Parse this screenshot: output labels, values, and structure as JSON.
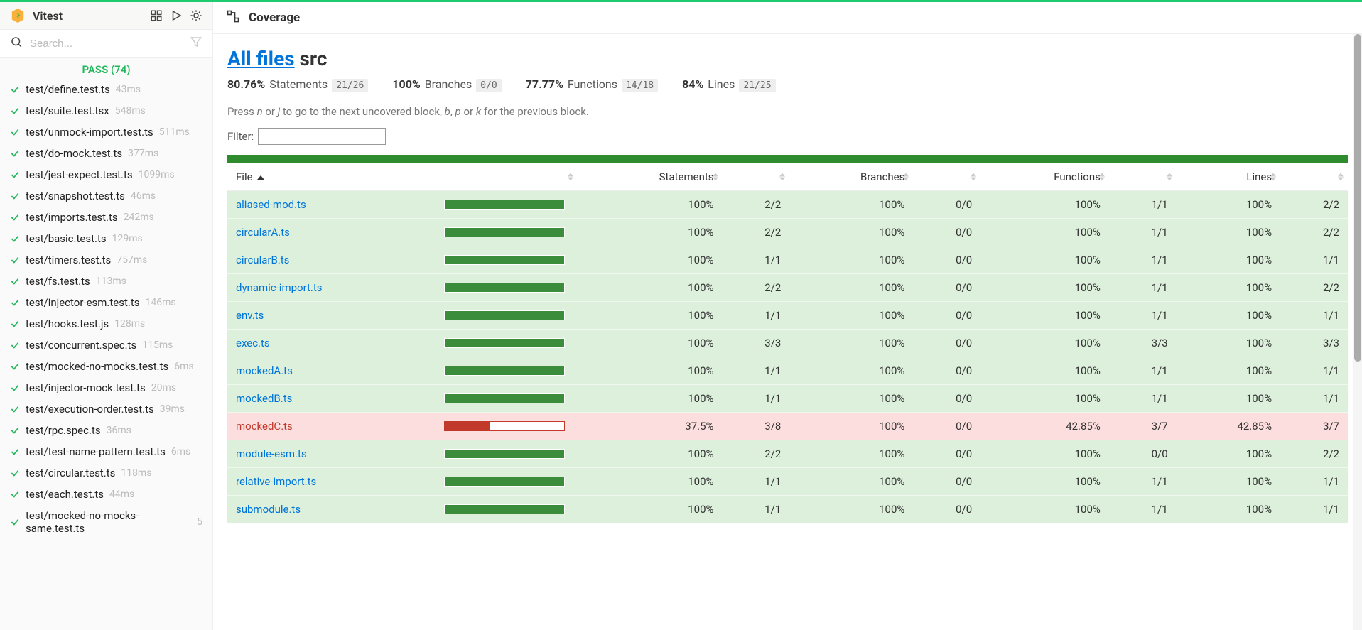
{
  "brand": "Vitest",
  "search_placeholder": "Search...",
  "status_pass_label": "PASS (74)",
  "coverage_header": "Coverage",
  "heading_link": "All files",
  "heading_rest": " src",
  "summary": {
    "statements": {
      "pct": "80.76%",
      "label": "Statements",
      "frac": "21/26"
    },
    "branches": {
      "pct": "100%",
      "label": "Branches",
      "frac": "0/0"
    },
    "functions": {
      "pct": "77.77%",
      "label": "Functions",
      "frac": "14/18"
    },
    "lines": {
      "pct": "84%",
      "label": "Lines",
      "frac": "21/25"
    }
  },
  "hint_html": "Press <i>n</i> or <i>j</i> to go to the next uncovered block, <i>b</i>, <i>p</i> or <i>k</i> for the previous block.",
  "filter_label": "Filter:",
  "table_headers": {
    "file": "File",
    "statements": "Statements",
    "branches": "Branches",
    "functions": "Functions",
    "lines": "Lines"
  },
  "tests": [
    {
      "name": "test/define.test.ts",
      "time": "43ms"
    },
    {
      "name": "test/suite.test.tsx",
      "time": "548ms"
    },
    {
      "name": "test/unmock-import.test.ts",
      "time": "511ms"
    },
    {
      "name": "test/do-mock.test.ts",
      "time": "377ms"
    },
    {
      "name": "test/jest-expect.test.ts",
      "time": "1099ms"
    },
    {
      "name": "test/snapshot.test.ts",
      "time": "46ms"
    },
    {
      "name": "test/imports.test.ts",
      "time": "242ms"
    },
    {
      "name": "test/basic.test.ts",
      "time": "129ms"
    },
    {
      "name": "test/timers.test.ts",
      "time": "757ms"
    },
    {
      "name": "test/fs.test.ts",
      "time": "113ms"
    },
    {
      "name": "test/injector-esm.test.ts",
      "time": "146ms"
    },
    {
      "name": "test/hooks.test.js",
      "time": "128ms"
    },
    {
      "name": "test/concurrent.spec.ts",
      "time": "115ms"
    },
    {
      "name": "test/mocked-no-mocks.test.ts",
      "time": "6ms"
    },
    {
      "name": "test/injector-mock.test.ts",
      "time": "20ms"
    },
    {
      "name": "test/execution-order.test.ts",
      "time": "39ms"
    },
    {
      "name": "test/rpc.spec.ts",
      "time": "36ms"
    },
    {
      "name": "test/test-name-pattern.test.ts",
      "time": "6ms"
    },
    {
      "name": "test/circular.test.ts",
      "time": "118ms"
    },
    {
      "name": "test/each.test.ts",
      "time": "44ms"
    },
    {
      "name": "test/mocked-no-mocks-same.test.ts",
      "time": "5"
    }
  ],
  "rows": [
    {
      "file": "aliased-mod.ts",
      "level": "high",
      "bar": 100,
      "s_pct": "100%",
      "s_frac": "2/2",
      "b_pct": "100%",
      "b_frac": "0/0",
      "f_pct": "100%",
      "f_frac": "1/1",
      "l_pct": "100%",
      "l_frac": "2/2"
    },
    {
      "file": "circularA.ts",
      "level": "high",
      "bar": 100,
      "s_pct": "100%",
      "s_frac": "2/2",
      "b_pct": "100%",
      "b_frac": "0/0",
      "f_pct": "100%",
      "f_frac": "1/1",
      "l_pct": "100%",
      "l_frac": "2/2"
    },
    {
      "file": "circularB.ts",
      "level": "high",
      "bar": 100,
      "s_pct": "100%",
      "s_frac": "1/1",
      "b_pct": "100%",
      "b_frac": "0/0",
      "f_pct": "100%",
      "f_frac": "1/1",
      "l_pct": "100%",
      "l_frac": "1/1"
    },
    {
      "file": "dynamic-import.ts",
      "level": "high",
      "bar": 100,
      "s_pct": "100%",
      "s_frac": "2/2",
      "b_pct": "100%",
      "b_frac": "0/0",
      "f_pct": "100%",
      "f_frac": "1/1",
      "l_pct": "100%",
      "l_frac": "2/2"
    },
    {
      "file": "env.ts",
      "level": "high",
      "bar": 100,
      "s_pct": "100%",
      "s_frac": "1/1",
      "b_pct": "100%",
      "b_frac": "0/0",
      "f_pct": "100%",
      "f_frac": "1/1",
      "l_pct": "100%",
      "l_frac": "1/1"
    },
    {
      "file": "exec.ts",
      "level": "high",
      "bar": 100,
      "s_pct": "100%",
      "s_frac": "3/3",
      "b_pct": "100%",
      "b_frac": "0/0",
      "f_pct": "100%",
      "f_frac": "3/3",
      "l_pct": "100%",
      "l_frac": "3/3"
    },
    {
      "file": "mockedA.ts",
      "level": "high",
      "bar": 100,
      "s_pct": "100%",
      "s_frac": "1/1",
      "b_pct": "100%",
      "b_frac": "0/0",
      "f_pct": "100%",
      "f_frac": "1/1",
      "l_pct": "100%",
      "l_frac": "1/1"
    },
    {
      "file": "mockedB.ts",
      "level": "high",
      "bar": 100,
      "s_pct": "100%",
      "s_frac": "1/1",
      "b_pct": "100%",
      "b_frac": "0/0",
      "f_pct": "100%",
      "f_frac": "1/1",
      "l_pct": "100%",
      "l_frac": "1/1"
    },
    {
      "file": "mockedC.ts",
      "level": "low",
      "bar": 37.5,
      "s_pct": "37.5%",
      "s_frac": "3/8",
      "b_pct": "100%",
      "b_frac": "0/0",
      "f_pct": "42.85%",
      "f_frac": "3/7",
      "l_pct": "42.85%",
      "l_frac": "3/7"
    },
    {
      "file": "module-esm.ts",
      "level": "high",
      "bar": 100,
      "s_pct": "100%",
      "s_frac": "2/2",
      "b_pct": "100%",
      "b_frac": "0/0",
      "f_pct": "100%",
      "f_frac": "0/0",
      "l_pct": "100%",
      "l_frac": "2/2"
    },
    {
      "file": "relative-import.ts",
      "level": "high",
      "bar": 100,
      "s_pct": "100%",
      "s_frac": "1/1",
      "b_pct": "100%",
      "b_frac": "0/0",
      "f_pct": "100%",
      "f_frac": "1/1",
      "l_pct": "100%",
      "l_frac": "1/1"
    },
    {
      "file": "submodule.ts",
      "level": "high",
      "bar": 100,
      "s_pct": "100%",
      "s_frac": "1/1",
      "b_pct": "100%",
      "b_frac": "0/0",
      "f_pct": "100%",
      "f_frac": "1/1",
      "l_pct": "100%",
      "l_frac": "1/1"
    }
  ],
  "chart_data": {
    "type": "table",
    "title": "Coverage — All files src",
    "columns": [
      "file",
      "statements_pct",
      "statements_frac",
      "branches_pct",
      "branches_frac",
      "functions_pct",
      "functions_frac",
      "lines_pct",
      "lines_frac"
    ],
    "rows": [
      [
        "aliased-mod.ts",
        100,
        "2/2",
        100,
        "0/0",
        100,
        "1/1",
        100,
        "2/2"
      ],
      [
        "circularA.ts",
        100,
        "2/2",
        100,
        "0/0",
        100,
        "1/1",
        100,
        "2/2"
      ],
      [
        "circularB.ts",
        100,
        "1/1",
        100,
        "0/0",
        100,
        "1/1",
        100,
        "1/1"
      ],
      [
        "dynamic-import.ts",
        100,
        "2/2",
        100,
        "0/0",
        100,
        "1/1",
        100,
        "2/2"
      ],
      [
        "env.ts",
        100,
        "1/1",
        100,
        "0/0",
        100,
        "1/1",
        100,
        "1/1"
      ],
      [
        "exec.ts",
        100,
        "3/3",
        100,
        "0/0",
        100,
        "3/3",
        100,
        "3/3"
      ],
      [
        "mockedA.ts",
        100,
        "1/1",
        100,
        "0/0",
        100,
        "1/1",
        100,
        "1/1"
      ],
      [
        "mockedB.ts",
        100,
        "1/1",
        100,
        "0/0",
        100,
        "1/1",
        100,
        "1/1"
      ],
      [
        "mockedC.ts",
        37.5,
        "3/8",
        100,
        "0/0",
        42.85,
        "3/7",
        42.85,
        "3/7"
      ],
      [
        "module-esm.ts",
        100,
        "2/2",
        100,
        "0/0",
        100,
        "0/0",
        100,
        "2/2"
      ],
      [
        "relative-import.ts",
        100,
        "1/1",
        100,
        "0/0",
        100,
        "1/1",
        100,
        "1/1"
      ],
      [
        "submodule.ts",
        100,
        "1/1",
        100,
        "0/0",
        100,
        "1/1",
        100,
        "1/1"
      ]
    ]
  }
}
